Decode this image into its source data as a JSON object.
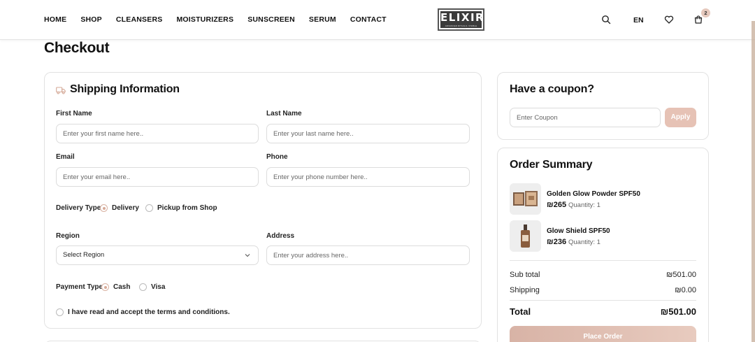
{
  "nav": [
    "HOME",
    "SHOP",
    "CLEANSERS",
    "MOISTURIZERS",
    "SUNSCREEN",
    "SERUM",
    "CONTACT"
  ],
  "logo": {
    "word": "ELIXIR",
    "tagline": "ADVANCED RITUALS. VISIBLE RESULTS"
  },
  "header": {
    "language": "EN",
    "cart_count": "2"
  },
  "page_title": "Checkout",
  "shipping": {
    "title": "Shipping Information",
    "first_name": {
      "label": "First Name",
      "placeholder": "Enter your first name here.."
    },
    "last_name": {
      "label": "Last Name",
      "placeholder": "Enter your last name here.."
    },
    "email": {
      "label": "Email",
      "placeholder": "Enter your email here.."
    },
    "phone": {
      "label": "Phone",
      "placeholder": "Enter your phone number here.."
    },
    "delivery_type": {
      "label": "Delivery Type :",
      "options": [
        "Delivery",
        "Pickup from Shop"
      ],
      "selected": "Delivery"
    },
    "region": {
      "label": "Region",
      "value": "Select Region"
    },
    "address": {
      "label": "Address",
      "placeholder": "Enter your address here.."
    },
    "payment_type": {
      "label": "Payment Type :",
      "options": [
        "Cash",
        "Visa"
      ],
      "selected": "Cash"
    },
    "terms": "I have read and accept the terms and conditions."
  },
  "coupon": {
    "title": "Have a coupon?",
    "placeholder": "Enter Coupon",
    "button": "Apply"
  },
  "summary": {
    "title": "Order Summary",
    "items": [
      {
        "name": "Golden Glow Powder SPF50",
        "price": "₪265",
        "qty": "Quantity: 1"
      },
      {
        "name": "Glow Shield SPF50",
        "price": "₪236",
        "qty": "Quantity: 1"
      }
    ],
    "subtotal_label": "Sub total",
    "subtotal": "₪501.00",
    "shipping_label": "Shipping",
    "shipping": "₪0.00",
    "total_label": "Total",
    "total": "₪501.00",
    "place_order": "Place Order"
  },
  "colors": {
    "accent": "#e6c2b5",
    "accent_dark": "#d7aa98",
    "logo_bg": "#3b3b3b"
  }
}
